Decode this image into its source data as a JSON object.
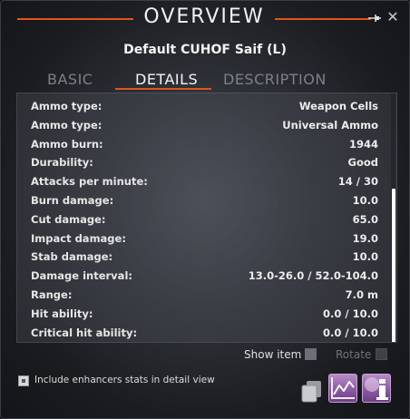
{
  "window": {
    "title": "OVERVIEW",
    "item_name": "Default CUHOF Saif (L)"
  },
  "tabs": [
    {
      "label": "BASIC",
      "active": false
    },
    {
      "label": "DETAILS",
      "active": true
    },
    {
      "label": "DESCRIPTION",
      "active": false
    }
  ],
  "details": [
    {
      "label": "Ammo type:",
      "value": "Weapon Cells"
    },
    {
      "label": "Ammo type:",
      "value": "Universal Ammo"
    },
    {
      "label": "Ammo burn:",
      "value": "1944"
    },
    {
      "label": "Durability:",
      "value": "Good"
    },
    {
      "label": "Attacks per minute:",
      "value": "14 / 30"
    },
    {
      "label": "Burn damage:",
      "value": "10.0"
    },
    {
      "label": "Cut damage:",
      "value": "65.0"
    },
    {
      "label": "Impact damage:",
      "value": "19.0"
    },
    {
      "label": "Stab damage:",
      "value": "10.0"
    },
    {
      "label": "Damage interval:",
      "value": "13.0-26.0 / 52.0-104.0"
    },
    {
      "label": "Range:",
      "value": "7.0 m"
    },
    {
      "label": "Hit ability:",
      "value": "0.0 / 10.0"
    },
    {
      "label": "Critical hit ability:",
      "value": "0.0 / 10.0"
    }
  ],
  "options": {
    "show_item_label": "Show item",
    "rotate_label": "Rotate",
    "include_enhancers_label": "Include enhancers stats in detail view"
  },
  "icons": {
    "pin": "pin-icon",
    "close": "close-icon",
    "copy": "copy-icon",
    "chart": "chart-icon",
    "info": "info-icon"
  },
  "colors": {
    "accent": "#e0541f",
    "action_button": "#8e5aa6"
  }
}
